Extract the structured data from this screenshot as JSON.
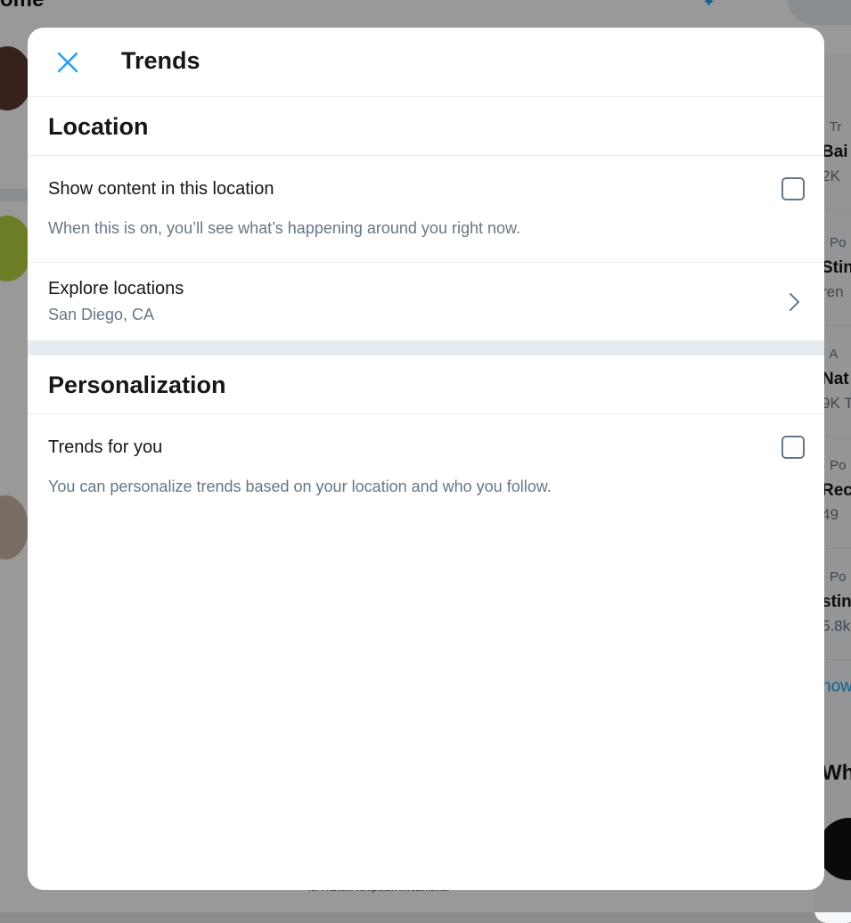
{
  "background": {
    "home_title": "ome",
    "trends": [
      {
        "meta": "· Tr",
        "name": "Bai",
        "count": "2K"
      },
      {
        "meta": "· Po",
        "name": "Stin",
        "count": "ren"
      },
      {
        "meta": "· A",
        "name": "Nat",
        "count": "9K T"
      },
      {
        "meta": "· Po",
        "name": "Rec",
        "count": "49"
      },
      {
        "meta": "· Po",
        "name": "stin",
        "count": "5.8k"
      }
    ],
    "show_more": "how",
    "who_heading": "Wh",
    "footer_text": "for Franklin Templeton Investments."
  },
  "modal": {
    "title": "Trends",
    "close_icon": "close-icon",
    "accent_color": "#1da1f2",
    "location": {
      "heading": "Location",
      "show_content": {
        "title": "Show content in this location",
        "description": "When this is on, you’ll see what’s happening around you right now.",
        "checked": false
      },
      "explore": {
        "title": "Explore locations",
        "value": "San Diego, CA",
        "icon": "chevron-right-icon"
      }
    },
    "personalization": {
      "heading": "Personalization",
      "trends_for_you": {
        "title": "Trends for you",
        "description": "You can personalize trends based on your location and who you follow.",
        "checked": false
      }
    }
  }
}
